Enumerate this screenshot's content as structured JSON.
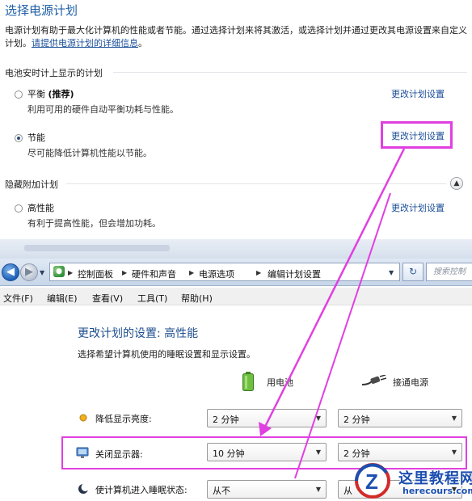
{
  "power_plans": {
    "title": "选择电源计划",
    "description_text": "电源计划有助于最大化计算机的性能或者节能。通过选择计划来将其激活，或选择计划并通过更改其电源设置来自定义计划。",
    "description_link": "请提供电源计划的详细信息",
    "description_end": "。",
    "battery_group_label": "电池安时计上显示的计划",
    "hidden_group_label": "隐藏附加计划",
    "plans": [
      {
        "name": "平衡",
        "tag": "(推荐)",
        "description": "利用可用的硬件自动平衡功耗与性能。",
        "link": "更改计划设置",
        "selected": false
      },
      {
        "name": "节能",
        "tag": "",
        "description": "尽可能降低计算机性能以节能。",
        "link": "更改计划设置",
        "selected": true
      }
    ],
    "hidden_plans": [
      {
        "name": "高性能",
        "description": "有利于提高性能，但会增加功耗。",
        "link": "更改计划设置",
        "selected": false
      }
    ]
  },
  "explorer": {
    "breadcrumbs": [
      "控制面板",
      "硬件和声音",
      "电源选项",
      "编辑计划设置"
    ],
    "search_placeholder": "搜索控制",
    "menu": [
      "文件(F)",
      "编辑(E)",
      "查看(V)",
      "工具(T)",
      "帮助(H)"
    ],
    "icons": {
      "back": "back-arrow-icon",
      "forward": "forward-arrow-icon",
      "refresh": "refresh-icon",
      "control_panel": "control-panel-icon"
    }
  },
  "plan_settings": {
    "title": "更改计划的设置: 高性能",
    "subtitle": "选择希望计算机使用的睡眠设置和显示设置。",
    "columns": {
      "battery": "用电池",
      "plugged": "接通电源"
    },
    "rows": [
      {
        "label": "降低显示亮度:",
        "icon": "brightness-icon",
        "battery_value": "2 分钟",
        "plugged_value": "2 分钟"
      },
      {
        "label": "关闭显示器:",
        "icon": "monitor-icon",
        "battery_value": "10 分钟",
        "plugged_value": "2 分钟"
      },
      {
        "label": "使计算机进入睡眠状态:",
        "icon": "sleep-moon-icon",
        "battery_value": "从不",
        "plugged_value": "从"
      }
    ]
  },
  "watermark": {
    "title": "这里教程网",
    "site": "herecours.com"
  },
  "colors": {
    "accent_link": "#1b4f99",
    "title_blue": "#1f5fa6",
    "annotation_magenta": "#e040e0"
  }
}
